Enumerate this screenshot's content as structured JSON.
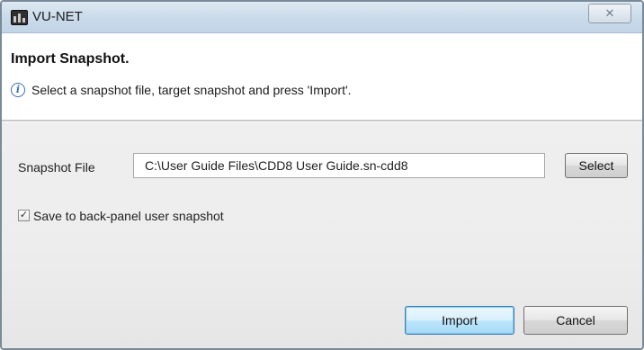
{
  "window": {
    "title": "VU-NET",
    "close_label": "✕"
  },
  "header": {
    "title": "Import Snapshot.",
    "info_icon": "info-icon",
    "info_text": "Select a snapshot file, target snapshot and press 'Import'."
  },
  "form": {
    "snapshot_file_label": "Snapshot File",
    "snapshot_file_value": "C:\\User Guide Files\\CDD8 User Guide.sn-cdd8",
    "select_label": "Select",
    "save_checkbox_checked": true,
    "save_checkbox_label": "Save to back-panel user snapshot"
  },
  "footer": {
    "import_label": "Import",
    "cancel_label": "Cancel"
  },
  "colors": {
    "titlebar": "#c9daea",
    "accent_button": "#bee6fd",
    "body_bg": "#ededed"
  }
}
